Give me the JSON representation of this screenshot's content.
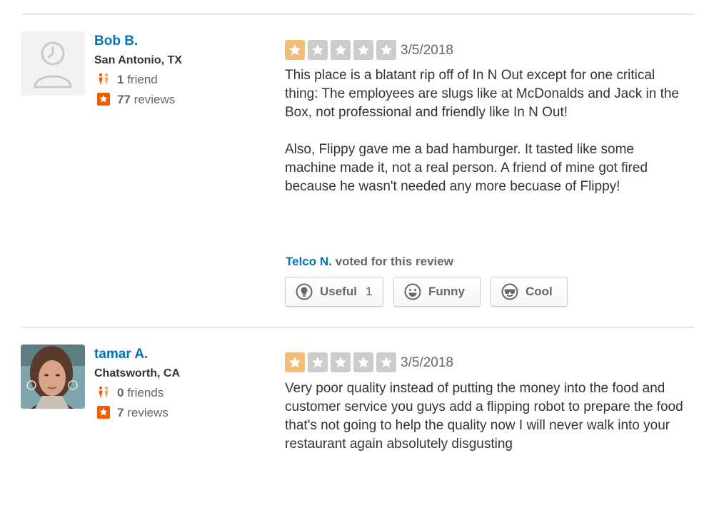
{
  "colors": {
    "link": "#0073bb",
    "star_on": "#f2bd79",
    "star_off": "#cccccc",
    "badge": "#f15c00"
  },
  "reviews": [
    {
      "user": {
        "name": "Bob B.",
        "location": "San Antonio, TX",
        "friends": "1",
        "friends_label": "friend",
        "reviews": "77",
        "reviews_label": "reviews",
        "avatar": "default-avatar"
      },
      "rating": 1,
      "date": "3/5/2018",
      "paragraphs": [
        "This place is a blatant rip off of In N Out except for one critical thing: The employees are slugs like at McDonalds and Jack in the Box, not professional and friendly like In N Out!",
        "Also, Flippy gave me a bad hamburger. It tasted like some machine made it, not a real person. A friend of mine got fired because he wasn't needed any more becuase of Flippy!"
      ],
      "voter": "Telco N.",
      "voted_text": "voted for this review",
      "buttons": {
        "useful": "Useful",
        "useful_count": "1",
        "funny": "Funny",
        "cool": "Cool"
      }
    },
    {
      "user": {
        "name": "tamar A.",
        "location": "Chatsworth, CA",
        "friends": "0",
        "friends_label": "friends",
        "reviews": "7",
        "reviews_label": "reviews",
        "avatar": "user-photo"
      },
      "rating": 1,
      "date": "3/5/2018",
      "paragraphs": [
        "Very poor quality instead of putting the money into the food and customer service you guys add a flipping robot to prepare the food that's not going to help the quality now I will never walk into your restaurant again absolutely disgusting"
      ]
    }
  ]
}
